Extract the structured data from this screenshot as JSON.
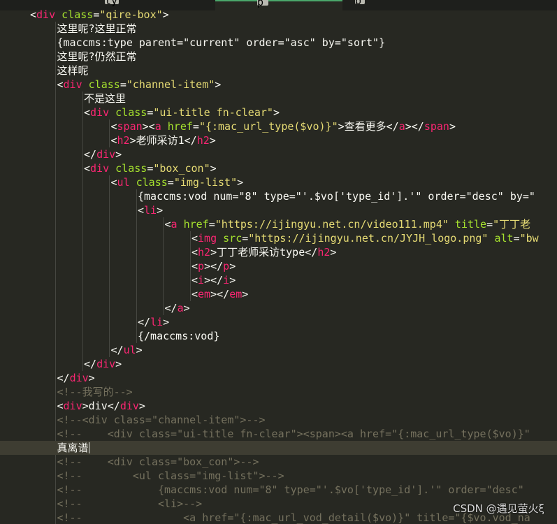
{
  "tab_bar": {
    "fragments": [
      "ty",
      "p",
      "b"
    ]
  },
  "editor": {
    "language": "html",
    "theme": "monokai-like",
    "active_line_index": 31,
    "lines": [
      {
        "indent": 1,
        "tokens": [
          [
            "plain",
            "<"
          ],
          [
            "tag",
            "div"
          ],
          [
            "plain",
            " "
          ],
          [
            "attr",
            "class"
          ],
          [
            "plain",
            "="
          ],
          [
            "str",
            "\"qire-box\""
          ],
          [
            "plain",
            ">"
          ]
        ]
      },
      {
        "indent": 2,
        "tokens": [
          [
            "plain",
            "这里呢?这里正常"
          ]
        ]
      },
      {
        "indent": 2,
        "tokens": [
          [
            "plain",
            "{maccms:type parent=\"current\" order=\"asc\" by=\"sort\"}"
          ]
        ]
      },
      {
        "indent": 2,
        "tokens": [
          [
            "plain",
            "这里呢?仍然正常"
          ]
        ]
      },
      {
        "indent": 2,
        "tokens": [
          [
            "plain",
            "这样呢"
          ]
        ]
      },
      {
        "indent": 2,
        "tokens": [
          [
            "plain",
            "<"
          ],
          [
            "tag",
            "div"
          ],
          [
            "plain",
            " "
          ],
          [
            "attr",
            "class"
          ],
          [
            "plain",
            "="
          ],
          [
            "str",
            "\"channel-item\""
          ],
          [
            "plain",
            ">"
          ]
        ]
      },
      {
        "indent": 3,
        "tokens": [
          [
            "plain",
            "不是这里"
          ]
        ]
      },
      {
        "indent": 3,
        "tokens": [
          [
            "plain",
            "<"
          ],
          [
            "tag",
            "div"
          ],
          [
            "plain",
            " "
          ],
          [
            "attr",
            "class"
          ],
          [
            "plain",
            "="
          ],
          [
            "str",
            "\"ui-title fn-clear\""
          ],
          [
            "plain",
            ">"
          ]
        ]
      },
      {
        "indent": 4,
        "tokens": [
          [
            "plain",
            "<"
          ],
          [
            "tag",
            "span"
          ],
          [
            "plain",
            "><"
          ],
          [
            "tag",
            "a"
          ],
          [
            "plain",
            " "
          ],
          [
            "attr",
            "href"
          ],
          [
            "plain",
            "="
          ],
          [
            "str",
            "\"{:mac_url_type($vo)}\""
          ],
          [
            "plain",
            ">查看更多</"
          ],
          [
            "tag",
            "a"
          ],
          [
            "plain",
            "></"
          ],
          [
            "tag",
            "span"
          ],
          [
            "plain",
            ">"
          ]
        ]
      },
      {
        "indent": 4,
        "tokens": [
          [
            "plain",
            "<"
          ],
          [
            "tag",
            "h2"
          ],
          [
            "plain",
            ">老师采访1</"
          ],
          [
            "tag",
            "h2"
          ],
          [
            "plain",
            ">"
          ]
        ]
      },
      {
        "indent": 3,
        "tokens": [
          [
            "plain",
            "</"
          ],
          [
            "tag",
            "div"
          ],
          [
            "plain",
            ">"
          ]
        ]
      },
      {
        "indent": 3,
        "tokens": [
          [
            "plain",
            "<"
          ],
          [
            "tag",
            "div"
          ],
          [
            "plain",
            " "
          ],
          [
            "attr",
            "class"
          ],
          [
            "plain",
            "="
          ],
          [
            "str",
            "\"box_con\""
          ],
          [
            "plain",
            ">"
          ]
        ]
      },
      {
        "indent": 4,
        "tokens": [
          [
            "plain",
            "<"
          ],
          [
            "tag",
            "ul"
          ],
          [
            "plain",
            " "
          ],
          [
            "attr",
            "class"
          ],
          [
            "plain",
            "="
          ],
          [
            "str",
            "\"img-list\""
          ],
          [
            "plain",
            ">"
          ]
        ]
      },
      {
        "indent": 5,
        "tokens": [
          [
            "plain",
            "{maccms:vod num=\"8\" type=\"'.$vo['type_id'].'\" order=\"desc\" by=\""
          ]
        ]
      },
      {
        "indent": 5,
        "tokens": [
          [
            "plain",
            "<"
          ],
          [
            "tag",
            "li"
          ],
          [
            "plain",
            ">"
          ]
        ]
      },
      {
        "indent": 6,
        "tokens": [
          [
            "plain",
            "<"
          ],
          [
            "tag",
            "a"
          ],
          [
            "plain",
            " "
          ],
          [
            "attr",
            "href"
          ],
          [
            "plain",
            "="
          ],
          [
            "str",
            "\"https://ijingyu.net.cn/video111.mp4\""
          ],
          [
            "plain",
            " "
          ],
          [
            "attr",
            "title"
          ],
          [
            "plain",
            "="
          ],
          [
            "str",
            "\"丁丁老"
          ]
        ]
      },
      {
        "indent": 7,
        "tokens": [
          [
            "plain",
            "<"
          ],
          [
            "tag",
            "img"
          ],
          [
            "plain",
            " "
          ],
          [
            "attr",
            "src"
          ],
          [
            "plain",
            "="
          ],
          [
            "str",
            "\"https://ijingyu.net.cn/JYJH_logo.png\""
          ],
          [
            "plain",
            " "
          ],
          [
            "attr",
            "alt"
          ],
          [
            "plain",
            "="
          ],
          [
            "str",
            "\"bw"
          ]
        ]
      },
      {
        "indent": 7,
        "tokens": [
          [
            "plain",
            "<"
          ],
          [
            "tag",
            "h2"
          ],
          [
            "plain",
            ">丁丁老师采访type</"
          ],
          [
            "tag",
            "h2"
          ],
          [
            "plain",
            ">"
          ]
        ]
      },
      {
        "indent": 7,
        "tokens": [
          [
            "plain",
            "<"
          ],
          [
            "tag",
            "p"
          ],
          [
            "plain",
            "></"
          ],
          [
            "tag",
            "p"
          ],
          [
            "plain",
            ">"
          ]
        ]
      },
      {
        "indent": 7,
        "tokens": [
          [
            "plain",
            "<"
          ],
          [
            "tag",
            "i"
          ],
          [
            "plain",
            "></"
          ],
          [
            "tag",
            "i"
          ],
          [
            "plain",
            ">"
          ]
        ]
      },
      {
        "indent": 7,
        "tokens": [
          [
            "plain",
            "<"
          ],
          [
            "tag",
            "em"
          ],
          [
            "plain",
            "></"
          ],
          [
            "tag",
            "em"
          ],
          [
            "plain",
            ">"
          ]
        ]
      },
      {
        "indent": 6,
        "tokens": [
          [
            "plain",
            "</"
          ],
          [
            "tag",
            "a"
          ],
          [
            "plain",
            ">"
          ]
        ]
      },
      {
        "indent": 5,
        "tokens": [
          [
            "plain",
            "</"
          ],
          [
            "tag",
            "li"
          ],
          [
            "plain",
            ">"
          ]
        ]
      },
      {
        "indent": 5,
        "tokens": [
          [
            "plain",
            "{/maccms:vod}"
          ]
        ]
      },
      {
        "indent": 4,
        "tokens": [
          [
            "plain",
            "</"
          ],
          [
            "tag",
            "ul"
          ],
          [
            "plain",
            ">"
          ]
        ]
      },
      {
        "indent": 3,
        "tokens": [
          [
            "plain",
            "</"
          ],
          [
            "tag",
            "div"
          ],
          [
            "plain",
            ">"
          ]
        ]
      },
      {
        "indent": 2,
        "tokens": [
          [
            "plain",
            "</"
          ],
          [
            "tag",
            "div"
          ],
          [
            "plain",
            ">"
          ]
        ]
      },
      {
        "indent": 2,
        "tokens": [
          [
            "comment",
            "<!--我写的-->"
          ]
        ]
      },
      {
        "indent": 2,
        "tokens": [
          [
            "plain",
            "<"
          ],
          [
            "tag",
            "div"
          ],
          [
            "plain",
            ">div</"
          ],
          [
            "tag",
            "div"
          ],
          [
            "plain",
            ">"
          ]
        ]
      },
      {
        "indent": 2,
        "tokens": [
          [
            "comment",
            "<!--<div class=\"channel-item\">-->"
          ]
        ]
      },
      {
        "indent": 2,
        "tokens": [
          [
            "comment",
            "<!--    <div class=\"ui-title fn-clear\"><span><a href=\"{:mac_url_type($vo)}\""
          ]
        ]
      },
      {
        "indent": 2,
        "tokens": [
          [
            "plain",
            "真离谱"
          ]
        ],
        "cursor": true
      },
      {
        "indent": 2,
        "tokens": [
          [
            "comment",
            "<!--    <div class=\"box_con\">-->"
          ]
        ]
      },
      {
        "indent": 2,
        "tokens": [
          [
            "comment",
            "<!--        <ul class=\"img-list\">-->"
          ]
        ]
      },
      {
        "indent": 2,
        "tokens": [
          [
            "comment",
            "<!--            {maccms:vod num=\"8\" type=\"'.$vo['type_id'].'\" order=\"desc\""
          ]
        ]
      },
      {
        "indent": 2,
        "tokens": [
          [
            "comment",
            "<!--            <li>-->"
          ]
        ]
      },
      {
        "indent": 2,
        "tokens": [
          [
            "comment",
            "<!--                <a href=\"{:mac_url_vod_detail($vo)}\" title=\"{$vo.vod_na"
          ]
        ]
      }
    ]
  },
  "watermark": {
    "text": "CSDN @遇见萤火ξ"
  }
}
